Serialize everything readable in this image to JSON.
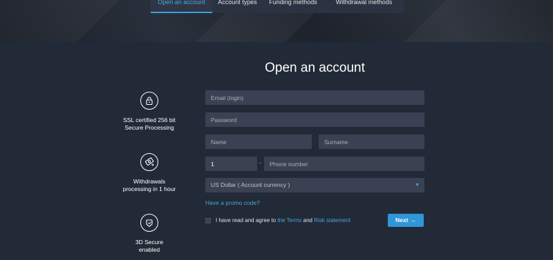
{
  "tabs": [
    {
      "label": "Open an account",
      "active": true
    },
    {
      "label": "Account types",
      "active": false
    },
    {
      "label": "Funding methods",
      "active": false
    },
    {
      "label": "Withdrawal methods",
      "active": false
    }
  ],
  "title": "Open an account",
  "features": [
    {
      "icon": "lock-icon",
      "line1": "SSL certified 256 bit",
      "line2": "Secure Processing"
    },
    {
      "icon": "money-transfer-icon",
      "line1": "Withdrawals",
      "line2": "processing in 1 hour"
    },
    {
      "icon": "secure-shield-icon",
      "line1": "3D Secure",
      "line2": "enabled"
    }
  ],
  "form": {
    "email_placeholder": "Email (login)",
    "password_placeholder": "Password",
    "name_placeholder": "Name",
    "surname_placeholder": "Surname",
    "country_code_value": "1",
    "phone_placeholder": "Phone number",
    "currency_selected": "US Dollar ( Account currency )",
    "promo_link": "Have a promo code?",
    "agree_text": "I have read and agree to",
    "terms_link": "the Terms",
    "and_text": "and",
    "risk_link": "Risk statement",
    "next_label": "Next",
    "next_arrow": "→"
  },
  "colors": {
    "accent": "#2f97d8",
    "background": "#222a37",
    "field": "#3a4152"
  }
}
